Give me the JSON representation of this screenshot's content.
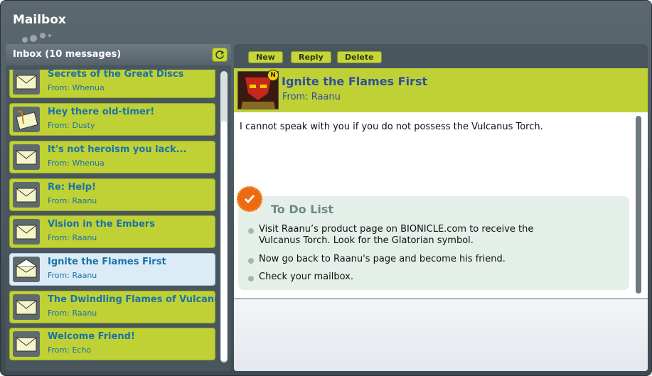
{
  "window": {
    "title": "Mailbox"
  },
  "inbox": {
    "title": "Inbox (10 messages)",
    "refresh_icon": "refresh-icon",
    "messages": [
      {
        "subject": "Secrets of the Great Discs",
        "from": "From: Whenua",
        "icon": "envelope-icon"
      },
      {
        "subject": "Hey there old-timer!",
        "from": "From: Dusty",
        "icon": "envelope-clip-icon"
      },
      {
        "subject": "It's not heroism you lack...",
        "from": "From: Whenua",
        "icon": "envelope-icon"
      },
      {
        "subject": "Re: Help!",
        "from": "From: Raanu",
        "icon": "envelope-icon"
      },
      {
        "subject": "Vision in the Embers",
        "from": "From: Raanu",
        "icon": "envelope-icon"
      },
      {
        "subject": "Ignite the Flames First",
        "from": "From: Raanu",
        "icon": "envelope-open-icon",
        "selected": true
      },
      {
        "subject": "The Dwindling Flames of Vulcanus",
        "from": "From: Raanu",
        "icon": "envelope-icon"
      },
      {
        "subject": "Welcome Friend!",
        "from": "From: Echo",
        "icon": "envelope-icon"
      }
    ]
  },
  "toolbar": {
    "new_label": "New",
    "reply_label": "Reply",
    "delete_label": "Delete"
  },
  "message": {
    "subject": "Ignite the Flames First",
    "from": "From: Raanu",
    "badge": "N",
    "body": "I cannot speak with you if you do not possess  the Vulcanus Torch."
  },
  "todo": {
    "title": "To Do List",
    "items": [
      "Visit Raanu’s product page on BIONICLE.com to receive the Vulcanus Torch. Look for the Glatorian symbol.",
      "Now go back to Raanu's page and become his friend.",
      "Check your mailbox."
    ]
  },
  "colors": {
    "accent": "#bfd135",
    "link": "#1b72a8",
    "frame": "#4a565e",
    "selected": "#dcecf6"
  }
}
